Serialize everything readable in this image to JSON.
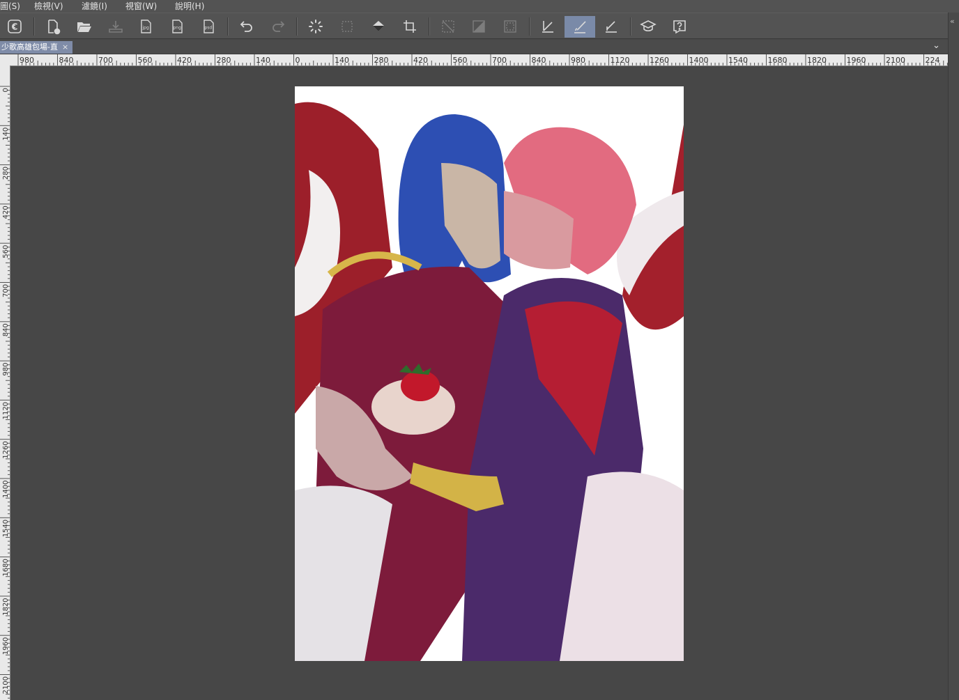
{
  "menu": [
    "圖(S)",
    "檢視(V)",
    "濾鏡(I)",
    "視窗(W)",
    "說明(H)"
  ],
  "toolbar": {
    "buttons": [
      {
        "name": "clip-studio-icon",
        "state": "normal"
      },
      {
        "name": "new-file-icon",
        "state": "normal"
      },
      {
        "name": "open-folder-icon",
        "state": "normal"
      },
      {
        "name": "save-icon",
        "state": "dim"
      },
      {
        "name": "export-jpg-icon",
        "state": "normal",
        "label": "jpg"
      },
      {
        "name": "export-png-icon",
        "state": "normal",
        "label": "png"
      },
      {
        "name": "export-psd-icon",
        "state": "normal",
        "label": "psd"
      },
      {
        "name": "undo-icon",
        "state": "normal"
      },
      {
        "name": "redo-icon",
        "state": "dim"
      },
      {
        "name": "loading-spinner-icon",
        "state": "normal"
      },
      {
        "name": "transform-icon",
        "state": "dim"
      },
      {
        "name": "fill-bucket-icon",
        "state": "normal"
      },
      {
        "name": "crop-icon",
        "state": "normal"
      },
      {
        "name": "clear-selection-icon",
        "state": "dim"
      },
      {
        "name": "invert-selection-icon",
        "state": "dim"
      },
      {
        "name": "selection-border-icon",
        "state": "dim"
      },
      {
        "name": "pen-snap-icon",
        "state": "normal"
      },
      {
        "name": "brush-snap-icon",
        "state": "active"
      },
      {
        "name": "ruler-snap-icon",
        "state": "normal"
      },
      {
        "name": "learn-icon",
        "state": "normal"
      },
      {
        "name": "help-icon",
        "state": "normal"
      }
    ]
  },
  "document_tab": {
    "title": "少歌高雄包場-直",
    "close": "×"
  },
  "ruler": {
    "horizontal": [
      "980",
      "840",
      "700",
      "560",
      "420",
      "280",
      "140",
      "0",
      "140",
      "280",
      "420",
      "560",
      "700",
      "840",
      "980",
      "1120",
      "1260",
      "1400",
      "1540",
      "1680",
      "1820",
      "1960",
      "2100",
      "224"
    ],
    "vertical": [
      "0",
      "140",
      "280",
      "420",
      "560",
      "700",
      "840",
      "980",
      "1120",
      "1260",
      "1400",
      "1540",
      "1680",
      "1820",
      "1960",
      "2100"
    ]
  },
  "colors": {
    "accent": "#7a8aa8",
    "workspace": "#474747",
    "toolbar": "#535353"
  }
}
